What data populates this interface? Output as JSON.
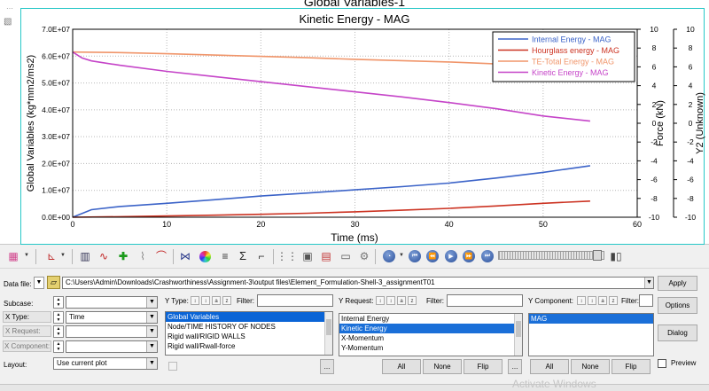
{
  "window": {
    "title": "Global Variables-1"
  },
  "chart_data": {
    "type": "line",
    "title": "Kinetic Energy - MAG",
    "xlabel": "Time (ms)",
    "ylabel": "Global Variables (kg*mm2/ms2)",
    "y2label": "Force (kN)",
    "y3label": "Y2 (Unknown)",
    "xlim": [
      0,
      60
    ],
    "ylim": [
      0,
      70000000
    ],
    "y2lim": [
      -10,
      10
    ],
    "y3lim": [
      -10,
      10
    ],
    "x_ticks": [
      "0",
      "10",
      "20",
      "30",
      "40",
      "50",
      "60"
    ],
    "y_ticks": [
      "0.0E+00",
      "1.0E+07",
      "2.0E+07",
      "3.0E+07",
      "4.0E+07",
      "5.0E+07",
      "6.0E+07",
      "7.0E+07"
    ],
    "y2_ticks": [
      "-10",
      "-8",
      "-6",
      "-4",
      "-2",
      "0",
      "2",
      "4",
      "6",
      "8",
      "10"
    ],
    "y3_ticks": [
      "-10",
      "-8",
      "-6",
      "-4",
      "-2",
      "0",
      "2",
      "4",
      "6",
      "8",
      "10"
    ],
    "grid": true,
    "legend_position": "top-right",
    "series": [
      {
        "name": "Internal Energy - MAG",
        "color": "#3b63c8",
        "x": [
          0,
          2,
          5,
          10,
          15,
          20,
          25,
          30,
          35,
          40,
          45,
          50,
          55
        ],
        "y": [
          0,
          2800000,
          4000000,
          5200000,
          6500000,
          7900000,
          9000000,
          10200000,
          11400000,
          12700000,
          14600000,
          16700000,
          19200000
        ]
      },
      {
        "name": "Hourglass energy - MAG",
        "color": "#cc3322",
        "x": [
          0,
          5,
          10,
          15,
          20,
          25,
          30,
          35,
          40,
          45,
          50,
          55
        ],
        "y": [
          0,
          200000,
          450000,
          750000,
          1100000,
          1500000,
          2000000,
          2600000,
          3300000,
          4200000,
          5200000,
          6000000
        ]
      },
      {
        "name": "TE-Total Energy - MAG",
        "color": "#f0956a",
        "x": [
          0,
          5,
          10,
          15,
          20,
          25,
          30,
          35,
          40,
          45,
          50,
          55
        ],
        "y": [
          61500000,
          61300000,
          60900000,
          60400000,
          59900000,
          59400000,
          58800000,
          58300000,
          57800000,
          57100000,
          56400000,
          55700000
        ]
      },
      {
        "name": "Kinetic Energy - MAG",
        "color": "#c544c8",
        "x": [
          0,
          1,
          2,
          5,
          10,
          15,
          20,
          25,
          30,
          35,
          40,
          45,
          50,
          55
        ],
        "y": [
          61500000,
          59300000,
          58200000,
          56600000,
          54300000,
          52400000,
          50500000,
          48600000,
          46700000,
          44800000,
          42700000,
          40400000,
          37700000,
          35800000
        ]
      }
    ]
  },
  "panel": {
    "data_file_label": "Data file:",
    "data_file_path": "C:\\Users\\Admin\\Downloads\\Crashworthiness\\Assignment-3\\output files\\Element_Formulation-Shell-3_assignmentT01",
    "apply_label": "Apply",
    "options_label": "Options",
    "dialog_label": "Dialog",
    "preview_label": "Preview",
    "subcase_label": "Subcase:",
    "x_type_label": "X Type:",
    "x_type_value": "Time",
    "x_request_label": "X Request:",
    "x_component_label": "X Component:",
    "layout_label": "Layout:",
    "layout_value": "Use current plot",
    "y_type_label": "Y Type:",
    "y_request_label": "Y Request:",
    "y_component_label": "Y Component:",
    "filter_label": "Filter:",
    "y_type_items": [
      "Global Variables",
      "Node/TIME HISTORY OF NODES",
      "Rigid wall/RIGID WALLS",
      "Rigid wall/Rwall-force"
    ],
    "y_request_items": [
      "Internal Energy",
      "Kinetic Energy",
      "X-Momentum",
      "Y-Momentum"
    ],
    "y_component_items": [
      "MAG"
    ],
    "all_label": "All",
    "none_label": "None",
    "flip_label": "Flip",
    "more_label": "...",
    "watermark": "Activate Windows"
  }
}
